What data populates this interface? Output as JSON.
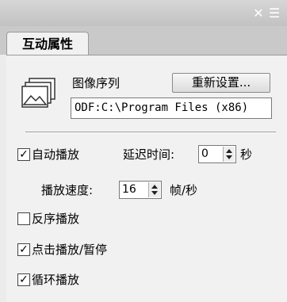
{
  "tab": {
    "label": "互动属性"
  },
  "image_sequence": {
    "label": "图像序列",
    "reset_button": "重新设置...",
    "path": "ODF:C:\\Program Files (x86)"
  },
  "autoplay": {
    "label": "自动播放",
    "checked": true,
    "delay_label": "延迟时间:",
    "delay_value": "0",
    "delay_unit": "秒"
  },
  "speed": {
    "label": "播放速度:",
    "value": "16",
    "unit": "帧/秒"
  },
  "options": [
    {
      "label": "反序播放",
      "checked": false
    },
    {
      "label": "点击播放/暂停",
      "checked": true
    },
    {
      "label": "循环播放",
      "checked": true
    }
  ],
  "icons": {
    "close": "close-icon",
    "menu": "panel-menu-icon",
    "image": "image-sequence-icon"
  }
}
